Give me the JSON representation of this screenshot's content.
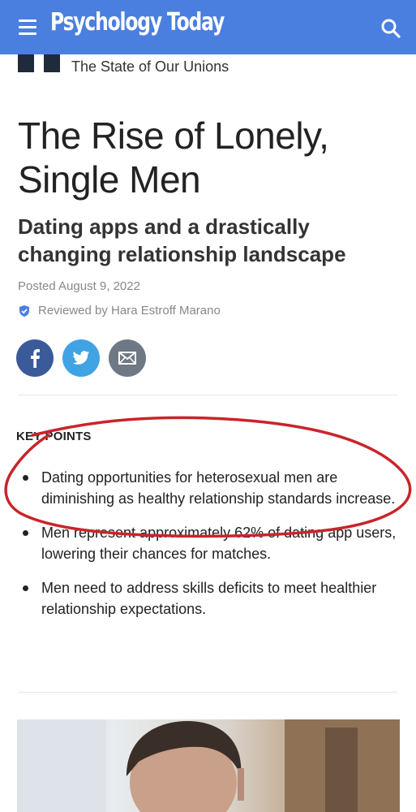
{
  "header": {
    "brand": "Psychology Today",
    "bg_color": "#4a7fe0",
    "menu_icon": "hamburger-icon",
    "search_icon": "search-icon"
  },
  "article": {
    "category": "The State of Our Unions",
    "title": "The Rise of Lonely, Single Men",
    "subtitle": "Dating apps and a drastically changing relationship landscape",
    "posted": "Posted August 9, 2022",
    "reviewed": "Reviewed by Hara Estroff Marano",
    "share_buttons": [
      "facebook-icon",
      "twitter-icon",
      "email-icon"
    ],
    "key_points_label": "KEY POINTS",
    "key_points": [
      "Dating opportunities for heterosexual men are diminishing as healthy relationship standards increase.",
      "Men represent approximately 62% of dating app users, lowering their chances for matches.",
      "Men need to address skills deficits to meet healthier relationship expectations."
    ]
  },
  "annotation": {
    "color": "#c8252b"
  }
}
